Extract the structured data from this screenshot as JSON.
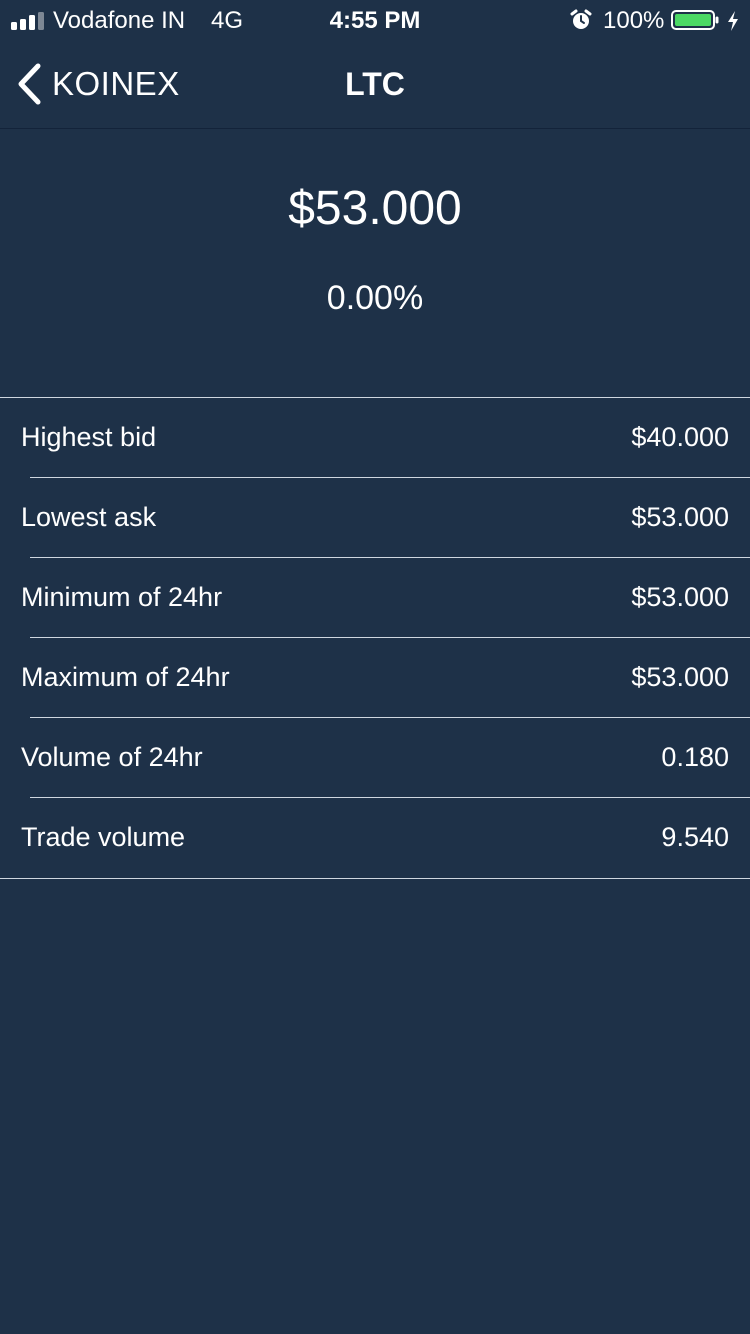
{
  "status_bar": {
    "carrier": "Vodafone IN",
    "network": "4G",
    "time": "4:55 PM",
    "battery": "100%",
    "battery_color": "#4cd964",
    "icons": [
      "signal-icon",
      "alarm-icon",
      "battery-icon",
      "charging-bolt-icon"
    ]
  },
  "nav": {
    "back_label": "KOINEX",
    "title": "LTC",
    "back_icon": "chevron-left-icon"
  },
  "ticker": {
    "price": "$53.000",
    "change": "0.00%"
  },
  "stats": [
    {
      "label": "Highest bid",
      "value": "$40.000"
    },
    {
      "label": "Lowest ask",
      "value": "$53.000"
    },
    {
      "label": "Minimum of 24hr",
      "value": "$53.000"
    },
    {
      "label": "Maximum of 24hr",
      "value": "$53.000"
    },
    {
      "label": "Volume of 24hr",
      "value": "0.180"
    },
    {
      "label": "Trade volume",
      "value": "9.540"
    }
  ],
  "colors": {
    "background": "#1e3148",
    "text": "#ffffff",
    "divider": "#cfd6df"
  }
}
